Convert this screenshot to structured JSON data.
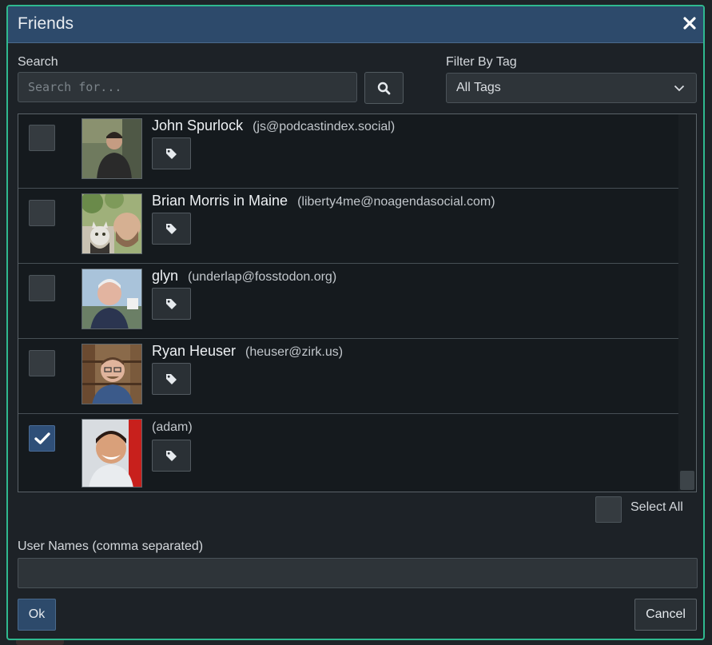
{
  "dialog": {
    "title": "Friends",
    "close_icon": "close-icon"
  },
  "search": {
    "label": "Search",
    "placeholder": "Search for...",
    "value": "",
    "button_icon": "search-icon"
  },
  "filter": {
    "label": "Filter By Tag",
    "selected": "All Tags",
    "icon": "chevron-down-icon"
  },
  "friends": [
    {
      "name": "John Spurlock",
      "handle": "(js@podcastindex.social)",
      "checked": false
    },
    {
      "name": "Brian Morris in Maine",
      "handle": "(liberty4me@noagendasocial.com)",
      "checked": false
    },
    {
      "name": "glyn",
      "handle": "(underlap@fosstodon.org)",
      "checked": false
    },
    {
      "name": "Ryan Heuser",
      "handle": "(heuser@zirk.us)",
      "checked": false
    },
    {
      "name": "",
      "handle": "(adam)",
      "checked": true
    }
  ],
  "select_all": {
    "label": "Select All",
    "checked": false
  },
  "usernames": {
    "label": "User Names (comma separated)",
    "value": ""
  },
  "buttons": {
    "ok": "Ok",
    "cancel": "Cancel"
  },
  "colors": {
    "accent_border": "#2fb98f",
    "titlebar": "#2d4a6b",
    "checked": "#2f4f78"
  }
}
